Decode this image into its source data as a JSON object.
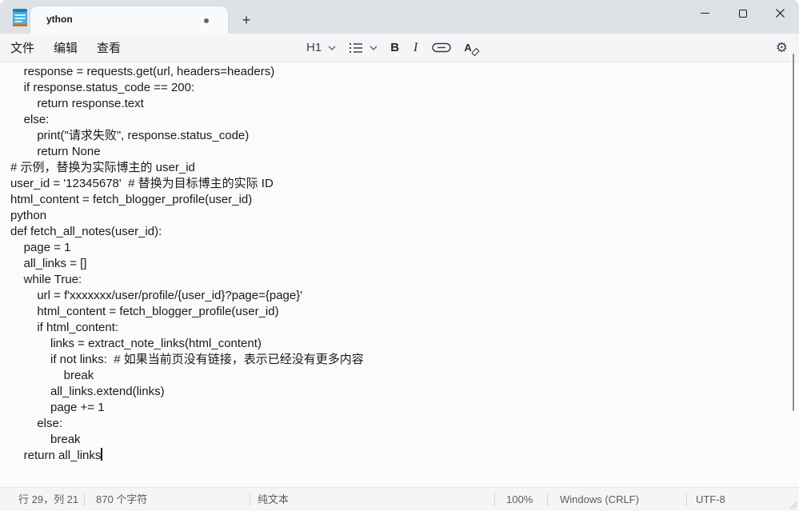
{
  "window": {
    "app": "Notepad",
    "tab_title": "ython",
    "unsaved_indicator": true
  },
  "titlebar": {
    "tab_label": "ython",
    "new_tab_label": "+"
  },
  "window_controls": {
    "icons": [
      "minimize-icon",
      "maximize-icon",
      "close-icon"
    ]
  },
  "menubar": {
    "items": [
      {
        "label": "文件"
      },
      {
        "label": "编辑"
      },
      {
        "label": "查看"
      }
    ]
  },
  "toolbar": {
    "heading_label": "H1",
    "bold_label": "B",
    "italic_label": "I",
    "icons": [
      "chevron-down-icon",
      "bullet-list-icon",
      "chevron-down-icon",
      "link-icon",
      "clear-format-icon",
      "settings-gear-icon"
    ]
  },
  "editor": {
    "lines_before_caret": [
      "    response = requests.get(url, headers=headers)",
      "    if response.status_code == 200:",
      "        return response.text",
      "    else:",
      "        print(\"请求失败\", response.status_code)",
      "        return None",
      "# 示例，替换为实际博主的 user_id",
      "user_id = '12345678'  # 替换为目标博主的实际 ID",
      "html_content = fetch_blogger_profile(user_id)",
      "python",
      "def fetch_all_notes(user_id):",
      "    page = 1",
      "    all_links = []",
      "    while True:",
      "        url = f'xxxxxxx/user/profile/{user_id}?page={page}'",
      "        html_content = fetch_blogger_profile(user_id)",
      "        if html_content:",
      "            links = extract_note_links(html_content)",
      "            if not links:  # 如果当前页没有链接，表示已经没有更多内容",
      "                break",
      "            all_links.extend(links)",
      "            page += 1",
      "        else:",
      "            break"
    ],
    "caret_line": "    return all_links"
  },
  "statusbar": {
    "position": "行 29，列 21",
    "char_count": "870 个字符",
    "doc_mode": "纯文本",
    "zoom_level": "100%",
    "line_ending": "Windows (CRLF)",
    "encoding": "UTF-8"
  },
  "colors": {
    "titlebar_bg": "#dee2e7",
    "tab_bg": "#f9fafb",
    "toolbar_bg": "#f4f5f7",
    "editor_bg": "#fbfbfb",
    "statusbar_bg": "#f4f5f7",
    "text": "#1a1a1a",
    "status_text": "#5c5c5c",
    "icon_blue": "#41b1e4",
    "icon_blue_dark": "#1b7fae",
    "icon_orange": "#c8742b"
  }
}
